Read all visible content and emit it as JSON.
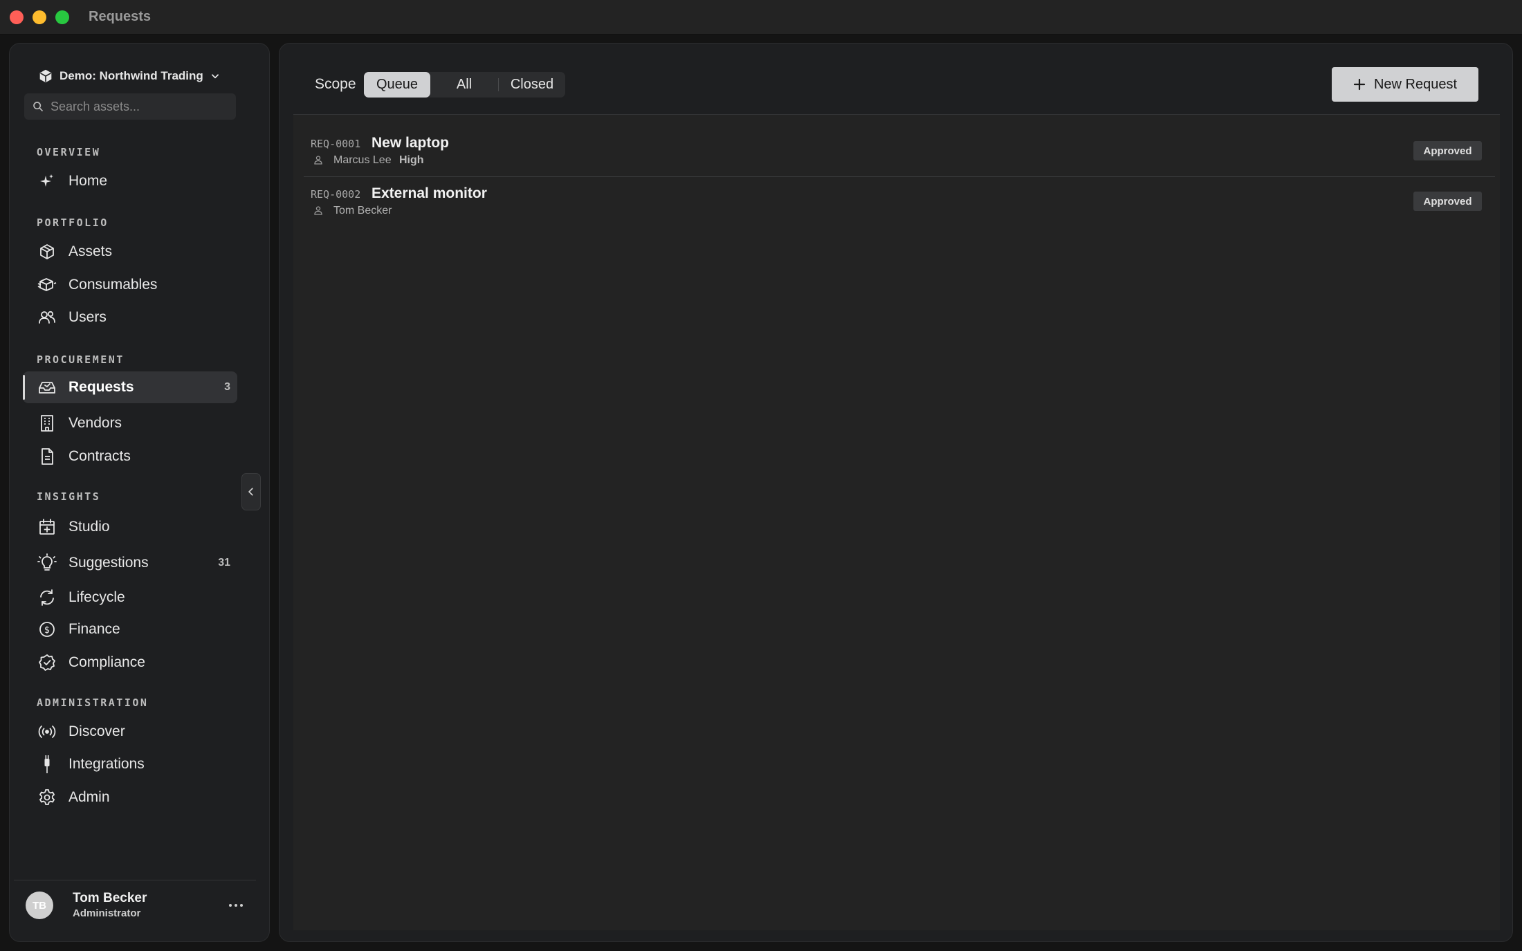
{
  "window": {
    "title": "Requests"
  },
  "sidebar": {
    "workspace": "Demo: Northwind Trading",
    "search_placeholder": "Search assets...",
    "sections": {
      "overview": "OVERVIEW",
      "portfolio": "PORTFOLIO",
      "procurement": "PROCUREMENT",
      "insights": "INSIGHTS",
      "administration": "ADMINISTRATION"
    },
    "items": {
      "home": {
        "label": "Home",
        "icon": "sparkle-icon"
      },
      "assets": {
        "label": "Assets",
        "icon": "cube-icon"
      },
      "consumables": {
        "label": "Consumables",
        "icon": "boxes-icon"
      },
      "users": {
        "label": "Users",
        "icon": "users-icon"
      },
      "requests": {
        "label": "Requests",
        "count": "3",
        "icon": "inbox-icon",
        "active": true
      },
      "vendors": {
        "label": "Vendors",
        "icon": "building-icon"
      },
      "contracts": {
        "label": "Contracts",
        "icon": "document-icon"
      },
      "studio": {
        "label": "Studio",
        "icon": "calendar-plus-icon"
      },
      "suggestions": {
        "label": "Suggestions",
        "count": "31",
        "icon": "lightbulb-icon"
      },
      "lifecycle": {
        "label": "Lifecycle",
        "icon": "refresh-icon"
      },
      "finance": {
        "label": "Finance",
        "icon": "dollar-circle-icon"
      },
      "compliance": {
        "label": "Compliance",
        "icon": "badge-check-icon"
      },
      "discover": {
        "label": "Discover",
        "icon": "radio-waves-icon"
      },
      "integrations": {
        "label": "Integrations",
        "icon": "plug-icon"
      },
      "admin": {
        "label": "Admin",
        "icon": "gear-icon"
      }
    },
    "user": {
      "initials": "TB",
      "name": "Tom Becker",
      "role": "Administrator"
    }
  },
  "main": {
    "scope_label": "Scope",
    "scopes": [
      "Queue",
      "All",
      "Closed"
    ],
    "active_scope": "Queue",
    "new_request_label": "New Request",
    "requests": [
      {
        "id": "REQ-0001",
        "title": "New laptop",
        "requester": "Marcus Lee",
        "priority": "High",
        "status": "Approved"
      },
      {
        "id": "REQ-0002",
        "title": "External monitor",
        "requester": "Tom Becker",
        "priority": "",
        "status": "Approved"
      }
    ]
  },
  "colors": {
    "background": "#141414",
    "panel": "#1e1f21",
    "accent_button": "#d0d1d3",
    "badge": "#3a3b3d"
  }
}
